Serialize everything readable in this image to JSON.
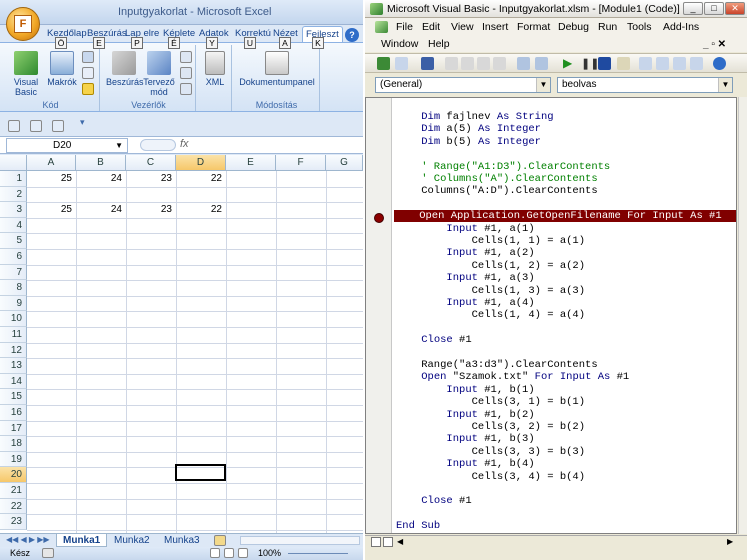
{
  "excel": {
    "title": "Inputgyakorlat - Microsoft Excel",
    "tabs": [
      {
        "label": "Kezdőlap",
        "key": "Ö"
      },
      {
        "label": "Beszúrás",
        "key": "E"
      },
      {
        "label": "Lap elre",
        "key": "P"
      },
      {
        "label": "Képlete",
        "key": "É"
      },
      {
        "label": "Adatok",
        "key": "Y"
      },
      {
        "label": "Korrektú",
        "key": "U"
      },
      {
        "label": "Nézet",
        "key": "A"
      },
      {
        "label": "Fejleszt",
        "key": "K"
      }
    ],
    "groups": {
      "kod": {
        "label": "Kód",
        "visual_basic": "Visual Basic",
        "makrok": "Makrók"
      },
      "vezerlok": {
        "label": "Vezérlők",
        "beszuras": "Beszúrás",
        "tervezo": "Tervező mód"
      },
      "xml": {
        "label": "XML"
      },
      "modositas": {
        "label": "Módosítás",
        "dokumentumpanel": "Dokumentumpanel"
      }
    },
    "name_box": "D20",
    "fx": "fx",
    "columns": [
      "A",
      "B",
      "C",
      "D",
      "E",
      "F",
      "G"
    ],
    "rows": [
      "1",
      "2",
      "3",
      "4",
      "5",
      "6",
      "7",
      "8",
      "9",
      "10",
      "11",
      "12",
      "13",
      "14",
      "15",
      "16",
      "17",
      "18",
      "19",
      "20",
      "21",
      "22",
      "23"
    ],
    "row1": [
      "25",
      "24",
      "23",
      "22"
    ],
    "row3": [
      "25",
      "24",
      "23",
      "22"
    ],
    "sheets": [
      "Munka1",
      "Munka2",
      "Munka3"
    ],
    "status": "Kész",
    "zoom": "100%"
  },
  "vba": {
    "title": "Microsoft Visual Basic - Inputgyakorlat.xlsm - [Module1 (Code)]",
    "menu": [
      "File",
      "Edit",
      "View",
      "Insert",
      "Format",
      "Debug",
      "Run",
      "Tools",
      "Add-Ins",
      "Window",
      "Help"
    ],
    "object_combo": "(General)",
    "proc_combo": "beolvas",
    "code": [
      "    Dim fajlnev As String",
      "    Dim a(5) As Integer",
      "    Dim b(5) As Integer",
      "",
      "    ' Range(\"A1:D3\").ClearContents",
      "    ' Columns(\"A\").ClearContents",
      "    Columns(\"A:D\").ClearContents",
      "",
      "    Open Application.GetOpenFilename For Input As #1",
      "        Input #1, a(1)",
      "            Cells(1, 1) = a(1)",
      "        Input #1, a(2)",
      "            Cells(1, 2) = a(2)",
      "        Input #1, a(3)",
      "            Cells(1, 3) = a(3)",
      "        Input #1, a(4)",
      "            Cells(1, 4) = a(4)",
      "",
      "    Close #1",
      "",
      "    Range(\"a3:d3\").ClearContents",
      "    Open \"Szamok.txt\" For Input As #1",
      "        Input #1, b(1)",
      "            Cells(3, 1) = b(1)",
      "        Input #1, b(2)",
      "            Cells(3, 2) = b(2)",
      "        Input #1, b(3)",
      "            Cells(3, 3) = b(3)",
      "        Input #1, b(4)",
      "            Cells(3, 4) = b(4)",
      "",
      "    Close #1",
      "",
      "End Sub"
    ],
    "breakpoint_line": 8,
    "colors": {
      "breakpoint": "#800000",
      "keyword": "#00007f",
      "comment": "#008000"
    }
  }
}
